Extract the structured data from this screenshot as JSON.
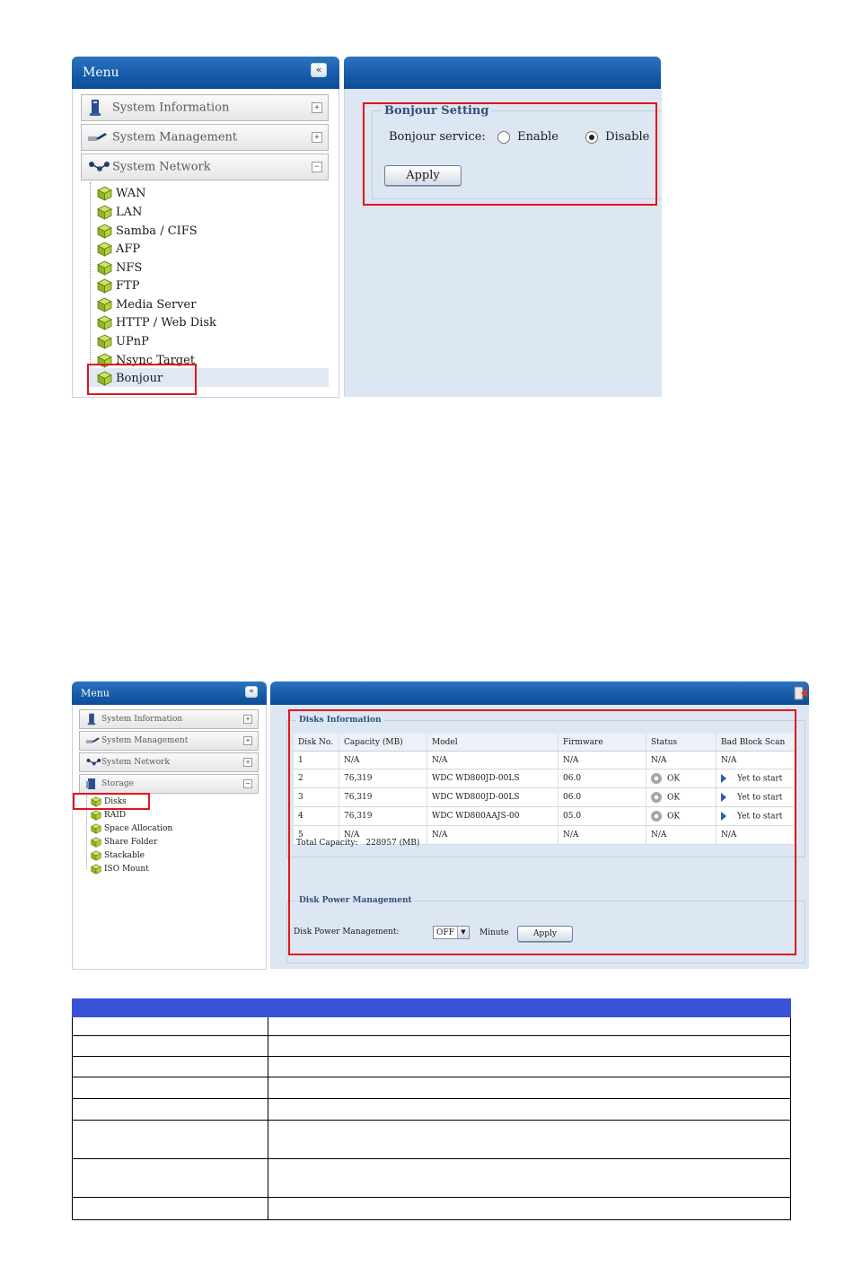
{
  "panel1": {
    "menu_title": "Menu",
    "collapse_glyph": "«",
    "sections": [
      {
        "label": "System Information",
        "toggle": "+",
        "icon": "computer-icon"
      },
      {
        "label": "System Management",
        "toggle": "+",
        "icon": "tools-icon"
      },
      {
        "label": "System Network",
        "toggle": "−",
        "icon": "network-icon"
      }
    ],
    "network_items": [
      "WAN",
      "LAN",
      "Samba / CIFS",
      "AFP",
      "NFS",
      "FTP",
      "Media Server",
      "HTTP / Web Disk",
      "UPnP",
      "Nsync Target",
      "Bonjour"
    ],
    "selected_item": "Bonjour",
    "bonjour": {
      "legend": "Bonjour Setting",
      "service_label": "Bonjour service:",
      "enable_label": "Enable",
      "disable_label": "Disable",
      "selected": "Disable",
      "apply_label": "Apply"
    }
  },
  "panel2": {
    "menu_title": "Menu",
    "collapse_glyph": "«",
    "sections": [
      {
        "label": "System Information",
        "toggle": "+",
        "icon": "computer-icon"
      },
      {
        "label": "System Management",
        "toggle": "+",
        "icon": "tools-icon"
      },
      {
        "label": "System Network",
        "toggle": "+",
        "icon": "network-icon"
      },
      {
        "label": "Storage",
        "toggle": "−",
        "icon": "storage-icon"
      }
    ],
    "storage_items": [
      "Disks",
      "RAID",
      "Space Allocation",
      "Share Folder",
      "Stackable",
      "ISO Mount"
    ],
    "selected_item": "Disks",
    "disks_info": {
      "legend": "Disks Information",
      "columns": [
        "Disk No.",
        "Capacity (MB)",
        "Model",
        "Firmware",
        "Status",
        "Bad Block Scan"
      ],
      "rows": [
        {
          "no": "1",
          "capacity": "N/A",
          "model": "N/A",
          "firmware": "N/A",
          "status": "N/A",
          "scan": "N/A",
          "has_icons": false
        },
        {
          "no": "2",
          "capacity": "76,319",
          "model": "WDC WD800JD-00LS",
          "firmware": "06.0",
          "status": "OK",
          "scan": "Yet to start",
          "has_icons": true
        },
        {
          "no": "3",
          "capacity": "76,319",
          "model": "WDC WD800JD-00LS",
          "firmware": "06.0",
          "status": "OK",
          "scan": "Yet to start",
          "has_icons": true
        },
        {
          "no": "4",
          "capacity": "76,319",
          "model": "WDC WD800AAJS-00",
          "firmware": "05.0",
          "status": "OK",
          "scan": "Yet to start",
          "has_icons": true
        },
        {
          "no": "5",
          "capacity": "N/A",
          "model": "N/A",
          "firmware": "N/A",
          "status": "N/A",
          "scan": "N/A",
          "has_icons": false
        }
      ],
      "total_label": "Total Capacity:",
      "total_value": "228957 (MB)"
    },
    "power": {
      "legend": "Disk Power Management",
      "label": "Disk Power Management:",
      "select_value": "OFF",
      "unit": "Minute",
      "apply_label": "Apply"
    }
  },
  "colors": {
    "header_blue": "#145aa8",
    "content_bg": "#dde6f3",
    "highlight_red": "#e0161b",
    "table_header": "#3a52d6"
  },
  "bottom_table": {
    "row_count": 11
  }
}
